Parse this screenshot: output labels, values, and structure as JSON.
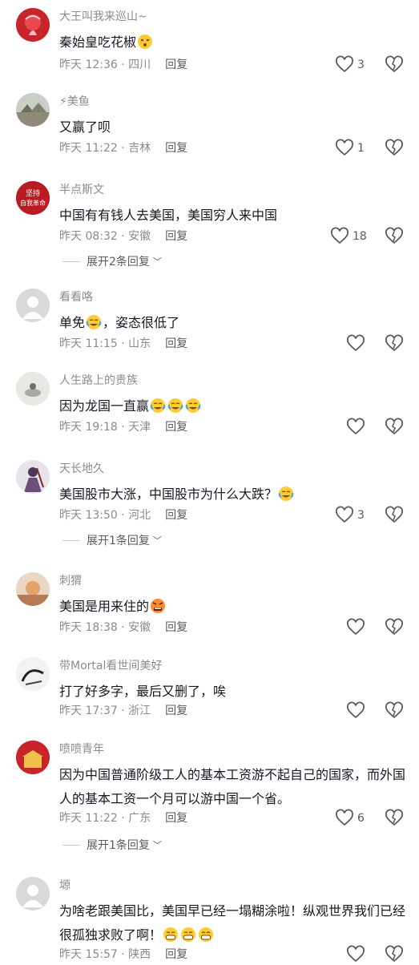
{
  "comments": [
    {
      "user": "大王叫我来巡山~",
      "text": "秦始皇吃花椒",
      "emojis": [
        "dizzy-face"
      ],
      "time": "昨天 12:36",
      "location": "四川",
      "reply": "回复",
      "likes": "3"
    },
    {
      "user": "⚡美鱼",
      "text": "又赢了呗",
      "emojis": [],
      "time": "昨天 11:22",
      "location": "吉林",
      "reply": "回复",
      "likes": "1"
    },
    {
      "user": "半点斯文",
      "text": "中国有有钱人去美国，美国穷人来中国",
      "emojis": [],
      "time": "昨天 08:32",
      "location": "安徽",
      "reply": "回复",
      "likes": "18",
      "expand": "展开2条回复"
    },
    {
      "user": "看看咯",
      "text": "单免",
      "text2": "，姿态很低了",
      "emojis": [
        "crying-laugh"
      ],
      "time": "昨天 11:15",
      "location": "山东",
      "reply": "回复",
      "likes": ""
    },
    {
      "user": "人生路上的贵族",
      "text": "因为龙国一直赢",
      "emojis": [
        "crying-laugh",
        "crying-laugh",
        "crying-laugh"
      ],
      "time": "昨天 19:18",
      "location": "天津",
      "reply": "回复",
      "likes": ""
    },
    {
      "user": "天长地久",
      "text": "美国股市大涨，中国股市为什么大跌？",
      "emojis": [
        "crying-laugh"
      ],
      "time": "昨天 13:50",
      "location": "河北",
      "reply": "回复",
      "likes": "3",
      "expand": "展开1条回复"
    },
    {
      "user": "刺猬",
      "text": "美国是用来住的",
      "emojis": [
        "angry-face"
      ],
      "time": "昨天 18:38",
      "location": "安徽",
      "reply": "回复",
      "likes": ""
    },
    {
      "user": "带Mortal看世间美好",
      "text": "打了好多字，最后又删了，唉",
      "emojis": [],
      "time": "昨天 17:37",
      "location": "浙江",
      "reply": "回复",
      "likes": ""
    },
    {
      "user": "喷喷青年",
      "text": "因为中国普通阶级工人的基本工资游不起自己的国家，而外国人的基本工资一个月可以游中国一个省。",
      "emojis": [],
      "time": "昨天 11:22",
      "location": "广东",
      "reply": "回复",
      "likes": "6",
      "expand": "展开1条回复"
    },
    {
      "user": "塬",
      "text": "为啥老跟美国比，美国早已经一塌糊涂啦！纵观世界我们已经很孤独求败了啊！",
      "emojis": [
        "grinning-face",
        "grinning-face",
        "grinning-face"
      ],
      "time": "昨天 15:57",
      "location": "陕西",
      "reply": "回复",
      "likes": ""
    }
  ],
  "avatars": {
    "c0": {
      "label": "",
      "color": "#c8252b"
    },
    "c2": {
      "label": "坚持自我革命",
      "color": "#b81c22"
    }
  },
  "colors": {
    "text": "#161823",
    "secondary": "#8a8b91",
    "reply": "#5a5b61"
  }
}
